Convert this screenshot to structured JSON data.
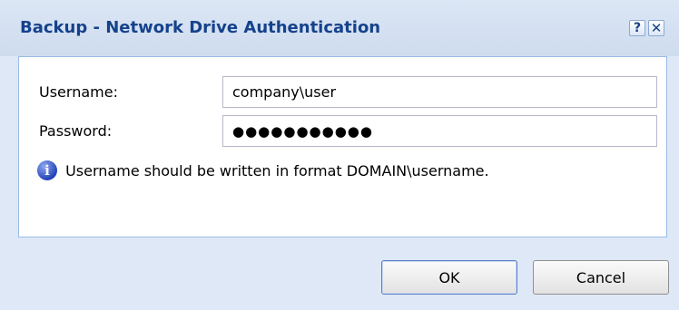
{
  "dialog": {
    "title": "Backup - Network Drive Authentication",
    "help_label": "?",
    "close_label": "✕"
  },
  "form": {
    "username_label": "Username:",
    "username_value": "company\\user",
    "password_label": "Password:",
    "password_value": "●●●●●●●●●●●",
    "info_icon": "info-icon",
    "info_text": "Username should be written in format DOMAIN\\username."
  },
  "buttons": {
    "ok_label": "OK",
    "cancel_label": "Cancel"
  },
  "colors": {
    "title": "#15428b",
    "frame": "#dfe8f6",
    "panel_border": "#99bbe8"
  }
}
